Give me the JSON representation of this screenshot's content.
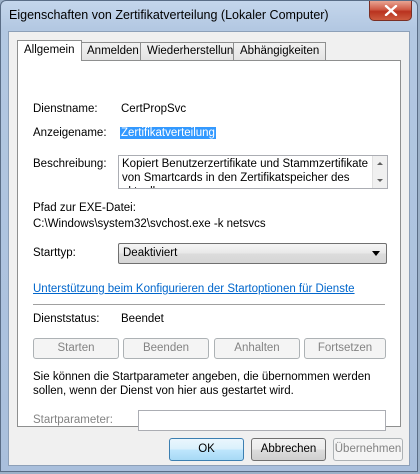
{
  "window": {
    "title": "Eigenschaften von Zertifikatverteilung (Lokaler Computer)"
  },
  "tabs": [
    {
      "label": "Allgemein"
    },
    {
      "label": "Anmelden"
    },
    {
      "label": "Wiederherstellung"
    },
    {
      "label": "Abhängigkeiten"
    }
  ],
  "general": {
    "service_name_label": "Dienstname:",
    "service_name": "CertPropSvc",
    "display_name_label": "Anzeigename:",
    "display_name": "Zertifikatverteilung",
    "description_label": "Beschreibung:",
    "description": "Kopiert Benutzerzertifikate und Stammzertifikate von Smartcards in den Zertifikatspeicher des aktuellen",
    "exe_path_label": "Pfad zur EXE-Datei:",
    "exe_path": "C:\\Windows\\system32\\svchost.exe -k netsvcs",
    "startup_type_label": "Starttyp:",
    "startup_type": "Deaktiviert",
    "help_link": "Unterstützung beim Konfigurieren der Startoptionen für Dienste",
    "status_label": "Dienststatus:",
    "status": "Beendet",
    "buttons": {
      "start": "Starten",
      "stop": "Beenden",
      "pause": "Anhalten",
      "resume": "Fortsetzen"
    },
    "params_info": "Sie können die Startparameter angeben, die übernommen werden sollen, wenn der Dienst von hier aus gestartet wird.",
    "params_label": "Startparameter:",
    "params_value": ""
  },
  "dialog_buttons": {
    "ok": "OK",
    "cancel": "Abbrechen",
    "apply": "Übernehmen"
  }
}
